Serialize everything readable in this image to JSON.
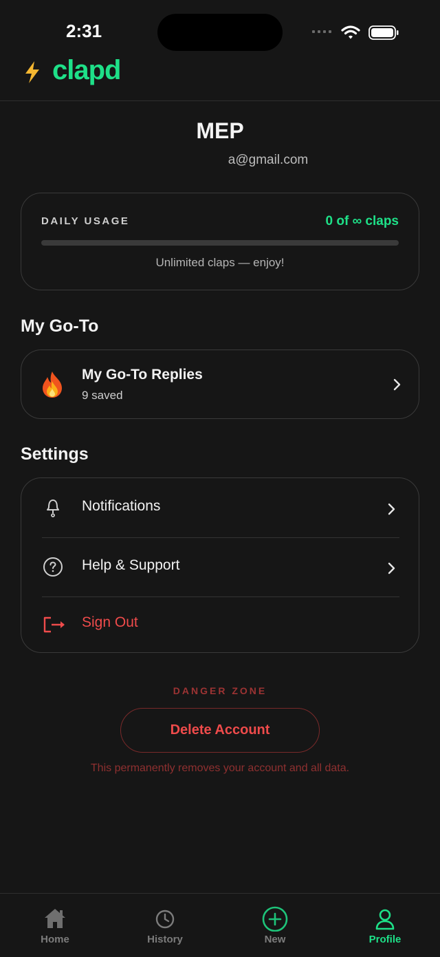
{
  "status_bar": {
    "time": "2:31"
  },
  "app": {
    "name": "clapd",
    "accent_color": "#1ee088",
    "danger_color": "#ef4b4b"
  },
  "profile": {
    "name": "MEP",
    "email": "a@gmail.com"
  },
  "usage": {
    "label": "DAILY USAGE",
    "count_text": "0 of ∞ claps",
    "progress_fraction": 0,
    "note": "Unlimited claps — enjoy!"
  },
  "goto": {
    "section_title": "My Go-To",
    "item": {
      "icon": "fire-icon",
      "title": "My Go-To Replies",
      "subtitle": "9 saved"
    }
  },
  "settings": {
    "section_title": "Settings",
    "items": [
      {
        "icon": "bell-icon",
        "label": "Notifications"
      },
      {
        "icon": "help-icon",
        "label": "Help & Support"
      },
      {
        "icon": "sign-out-icon",
        "label": "Sign Out"
      }
    ]
  },
  "danger": {
    "label": "DANGER ZONE",
    "button": "Delete Account",
    "note": "This permanently removes your account and all data."
  },
  "tabs": [
    {
      "icon": "home-icon",
      "label": "Home"
    },
    {
      "icon": "clock-icon",
      "label": "History"
    },
    {
      "icon": "plus-circle-icon",
      "label": "New"
    },
    {
      "icon": "user-icon",
      "label": "Profile",
      "active": true
    }
  ]
}
